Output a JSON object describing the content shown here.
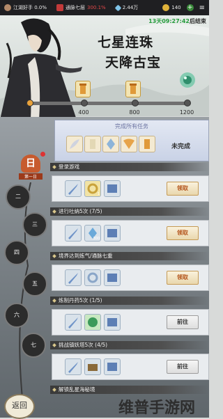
{
  "topbar": {
    "status1": "江湖好手 0.0%",
    "status2": "通脉七层",
    "status2_pct": "300.1%",
    "value": "2.44万",
    "energy": "140"
  },
  "header": {
    "timer": "13天09:27:42",
    "timer_suffix": "后结束",
    "title_line1": "七星连珠",
    "title_line2": "天降古宝"
  },
  "progress": {
    "value": 0,
    "max": 1200,
    "milestones": [
      "0",
      "400",
      "800",
      "1200"
    ]
  },
  "summary": {
    "header": "完成所有任务",
    "status": "未完成"
  },
  "days": {
    "first_label": "第一日",
    "first_badge": "日",
    "items": [
      "二",
      "三",
      "四",
      "五",
      "六",
      "七"
    ]
  },
  "tasks": [
    {
      "title": "登录游戏",
      "qty": "1",
      "button": "领取"
    },
    {
      "title": "进行吐纳5次 (7/5)",
      "qty": "300",
      "button": "领取"
    },
    {
      "title": "境界达到炼气/通脉七重",
      "qty": "",
      "button": "领取"
    },
    {
      "title": "炼制丹药5次 (1/5)",
      "qty": "",
      "button": "前往"
    },
    {
      "title": "挑战镇妖塔5次 (4/5)",
      "qty": "",
      "button": "前往"
    },
    {
      "title": "解锁乱星海秘境",
      "qty": "",
      "button": ""
    }
  ],
  "back_button": "返回",
  "watermark": "维普手游网",
  "colors": {
    "accent": "#e9a23b",
    "button_text": "#b4551c",
    "go_text": "#333333"
  }
}
